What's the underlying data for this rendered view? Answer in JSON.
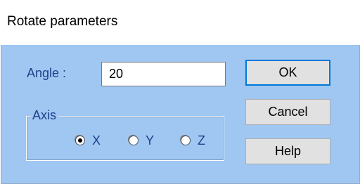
{
  "window": {
    "title": "Rotate parameters"
  },
  "angle": {
    "label": "Angle :",
    "value": "20"
  },
  "axis": {
    "legend": "Axis",
    "options": [
      {
        "label": "X",
        "checked": true
      },
      {
        "label": "Y",
        "checked": false
      },
      {
        "label": "Z",
        "checked": false
      }
    ]
  },
  "buttons": {
    "ok": "OK",
    "cancel": "Cancel",
    "help": "Help"
  },
  "colors": {
    "client_bg": "#9fc7f2",
    "label_text": "#1f3f8a",
    "default_button_border": "#0078d7"
  }
}
